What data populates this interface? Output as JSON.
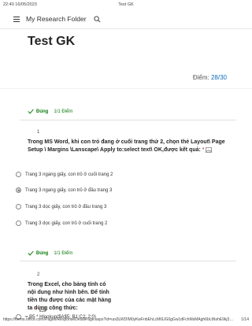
{
  "print_header": {
    "datetime": "22:40 16/05/2023",
    "tab_title": "Test GK"
  },
  "topbar": {
    "folder_title": "My Research Folder"
  },
  "page": {
    "title": "Test GK",
    "score_label": "Điểm:",
    "score_value": "28/30"
  },
  "questions": [
    {
      "status": "Đúng",
      "points": "1/1 Điểm",
      "number": "1",
      "text": "Trong MS Word, khi con trỏ đang ở cuối trang thứ 2, chọn thẻ Layout\\ Page Setup \\ Margins \\Lanscape\\ Apply to:select text\\ OK,được kết quả:",
      "required_mark": "*",
      "options": [
        {
          "label": "Trang 3 ngang giấy, con trỏ ở cuối trang 2",
          "selected": false
        },
        {
          "label": "Trang 3 ngang giấy, con trỏ ở đầu trang 3",
          "selected": true
        },
        {
          "label": "Trang 3 dọc giấy, con trỏ ở đầu trang 3",
          "selected": false
        },
        {
          "label": "Trang 3 dọc giấy, con trỏ ở cuối trang 2",
          "selected": false
        }
      ]
    },
    {
      "status": "Đúng",
      "points": "1/1 Điểm",
      "number": "2",
      "text": "Trong Excel, cho bảng tính có nội dung như hình bên. Để tính tiền thu được của các mặt hàng ta dùng công thức:",
      "required_mark": "*",
      "options": [
        {
          "label": "= B5 * Hlookup($A$5; B1:C2; 2;0)",
          "selected": false
        }
      ]
    }
  ],
  "print_footer": {
    "url": "https://forms.office.com/Pages/ResponseDetailPage.aspx?id=uoi3LWDIM0yKwFnbEhLcM6UG0gGw1dFchMsMAgh6bLtNshE9kj3MU5EWTAyIVQ5U...",
    "page": "1/14"
  },
  "colors": {
    "accent": "#0f6cbd",
    "correct": "#107c10",
    "required": "#a4262c"
  }
}
